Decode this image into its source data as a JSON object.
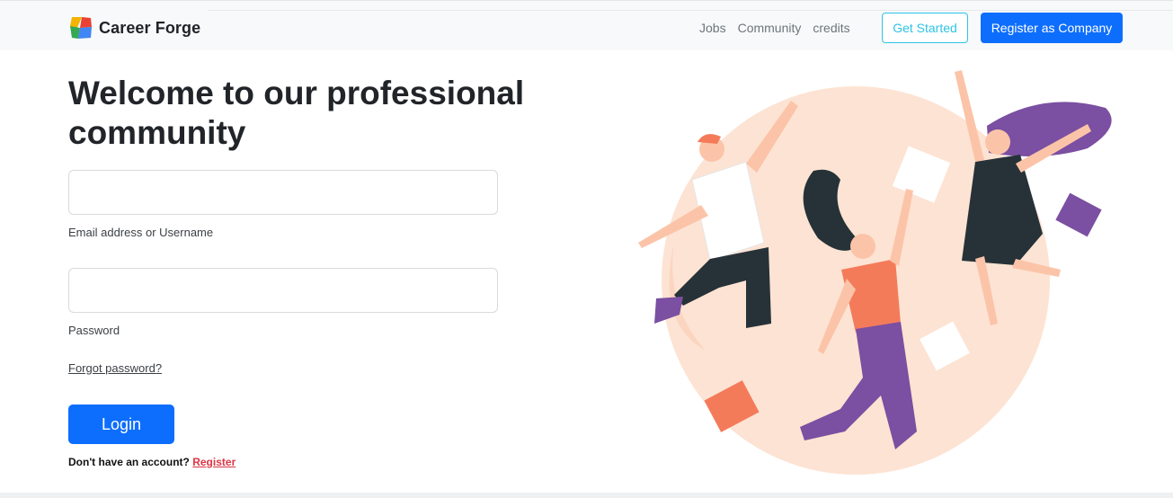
{
  "brand": {
    "name": "Career Forge",
    "logo_icon": "colorful-square-logo-icon"
  },
  "nav": {
    "links": [
      "Jobs",
      "Community",
      "credits"
    ],
    "get_started": "Get Started",
    "register_company": "Register as Company"
  },
  "main": {
    "heading": "Welcome to our professional community",
    "email_label": "Email address or Username",
    "password_label": "Password",
    "email_value": "",
    "password_value": "",
    "forgot_password": "Forgot password?",
    "login_button": "Login",
    "no_account_text": "Don't have an account?",
    "register_link": "Register"
  },
  "illustration": {
    "icon": "jumping-people-celebration-illustration"
  },
  "colors": {
    "primary": "#0d6efd",
    "outline": "#2ec4e6",
    "danger": "#dc3545",
    "navbar_bg": "#f8f9fa",
    "illustration_circle": "#fde3d3",
    "purple": "#7b4fa1",
    "orange": "#f47b5a",
    "dark": "#263238"
  }
}
